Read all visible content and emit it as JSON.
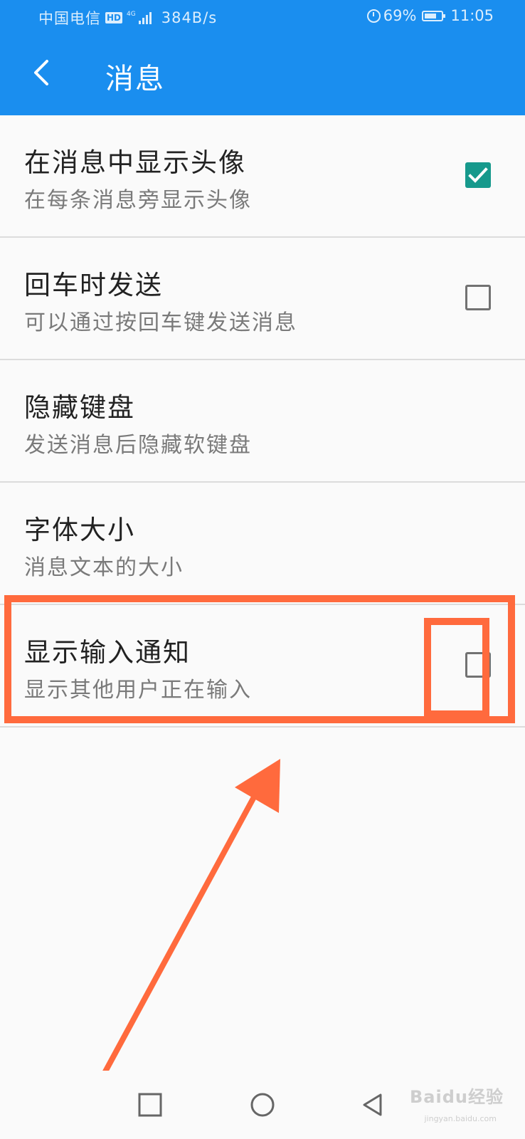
{
  "status_bar": {
    "carrier": "中国电信",
    "hd_badge": "HD",
    "network_label": "4G",
    "speed": "384B/s",
    "battery": "69%",
    "time": "11:05"
  },
  "app_bar": {
    "title": "消息",
    "back_icon": "chevron-left-icon"
  },
  "settings": [
    {
      "title": "在消息中显示头像",
      "subtitle": "在每条消息旁显示头像",
      "checkbox": true,
      "checked": true
    },
    {
      "title": "回车时发送",
      "subtitle": "可以通过按回车键发送消息",
      "checkbox": true,
      "checked": false
    },
    {
      "title": "隐藏键盘",
      "subtitle": "发送消息后隐藏软键盘",
      "checkbox": false,
      "checked": false
    },
    {
      "title": "字体大小",
      "subtitle": "消息文本的大小",
      "checkbox": false,
      "checked": false
    },
    {
      "title": "显示输入通知",
      "subtitle": "显示其他用户正在输入",
      "checkbox": true,
      "checked": false
    }
  ],
  "annotation": {
    "color": "#ff6a3d",
    "highlighted_item": "显示输入通知"
  },
  "nav_bar": {
    "recents_icon": "square-icon",
    "home_icon": "circle-icon",
    "back_icon": "triangle-back-icon"
  },
  "watermark": {
    "text": "Baidu经验",
    "sub": "jingyan.baidu.com"
  },
  "colors": {
    "primary": "#1a8eef",
    "checkbox_checked": "#16998c",
    "background": "#fafafa",
    "annotation": "#ff6a3d"
  }
}
